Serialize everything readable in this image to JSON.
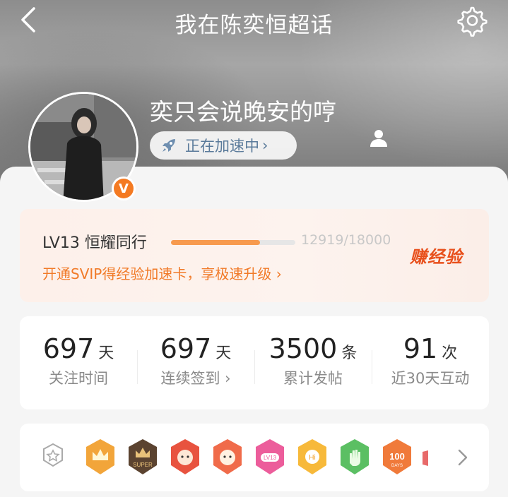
{
  "header": {
    "title": "我在陈奕恒超话"
  },
  "profile": {
    "username": "奕只会说晚安的哼",
    "boost_label": "正在加速中",
    "boost_chevron": "›"
  },
  "level": {
    "label": "LV13 恒耀同行",
    "progress_text": "12919/18000",
    "progress_fraction": 0.7177,
    "svip_link": "开通SVIP得经验加速卡，享极速升级 ›",
    "earn_button": "赚经验"
  },
  "stats": [
    {
      "value": "697",
      "unit": "天",
      "label": "关注时间"
    },
    {
      "value": "697",
      "unit": "天",
      "label": "连续签到 ›"
    },
    {
      "value": "3500",
      "unit": "条",
      "label": "累计发帖"
    },
    {
      "value": "91",
      "unit": "次",
      "label": "近30天互动"
    }
  ],
  "badges": [
    {
      "icon": "badge-lock-icon"
    },
    {
      "icon": "badge-crown-orange-icon",
      "color": "#f2a53a"
    },
    {
      "icon": "badge-super-crown-icon",
      "color": "#5b4330",
      "text": "SUPER"
    },
    {
      "icon": "badge-cat-red-icon",
      "color": "#e8533f"
    },
    {
      "icon": "badge-cat-orange-icon",
      "color": "#f06b4a"
    },
    {
      "icon": "badge-lv13-icon",
      "color": "#ec5d9b",
      "text": "LV13"
    },
    {
      "icon": "badge-hi-icon",
      "color": "#f7b93a",
      "text": "Hi"
    },
    {
      "icon": "badge-hand-icon",
      "color": "#5bbf63"
    },
    {
      "icon": "badge-100-days-icon",
      "color": "#f07a3a",
      "text": "100"
    }
  ],
  "colors": {
    "accent": "#f17a28",
    "earn": "#e8501c",
    "boost_text": "#5a7a9a"
  }
}
